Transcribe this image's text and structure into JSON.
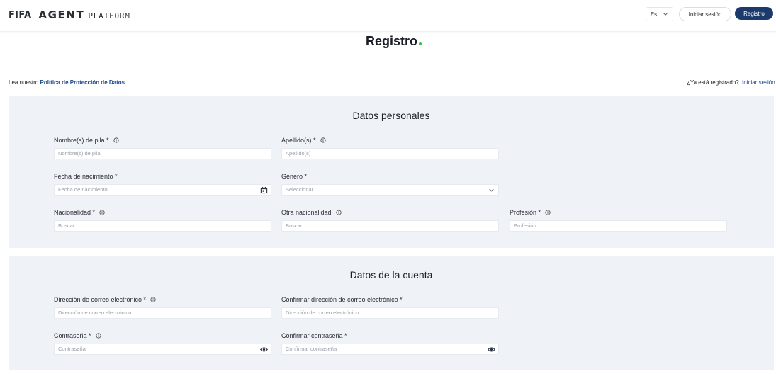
{
  "header": {
    "logo": {
      "fifa": "FIFA",
      "agent": "AGENT",
      "platform": "PLATFORM"
    },
    "language": "Es",
    "login_label": "Iniciar sesión",
    "register_label": "Registro"
  },
  "page": {
    "title": "Registro"
  },
  "info": {
    "prefix": "Lea nuestro",
    "policy_link": "Política de Protección de Datos",
    "already_registered": "¿Ya está registrado?",
    "login_link": "Iniciar sesión"
  },
  "personal": {
    "title": "Datos personales",
    "first_name": {
      "label": "Nombre(s) de pila *",
      "placeholder": "Nombre(s) de pila"
    },
    "last_name": {
      "label": "Apellido(s) *",
      "placeholder": "Apellido(s)"
    },
    "birth_date": {
      "label": "Fecha de nacimiento *",
      "placeholder": "Fecha de nacimiento"
    },
    "gender": {
      "label": "Género *",
      "placeholder": "Seleccionar"
    },
    "nationality": {
      "label": "Nacionalidad *",
      "placeholder": "Buscar"
    },
    "other_nationality": {
      "label": "Otra nacionalidad",
      "placeholder": "Buscar"
    },
    "profession": {
      "label": "Profesión *",
      "placeholder": "Profesión"
    }
  },
  "account": {
    "title": "Datos de la cuenta",
    "email": {
      "label": "Dirección de correo electrónico *",
      "placeholder": "Dirección de correo electrónico"
    },
    "confirm_email": {
      "label": "Confirmar dirección de correo electrónico *",
      "placeholder": "Dirección de correo electrónico"
    },
    "password": {
      "label": "Contraseña *",
      "placeholder": "Contraseña"
    },
    "confirm_password": {
      "label": "Confirmar contraseña *",
      "placeholder": "Confirmar contraseña"
    }
  },
  "colors": {
    "primary": "#1c3a6b",
    "link": "#1f4b8b",
    "section_bg": "#eff2f6",
    "accent_dot": "#2bc24c"
  }
}
